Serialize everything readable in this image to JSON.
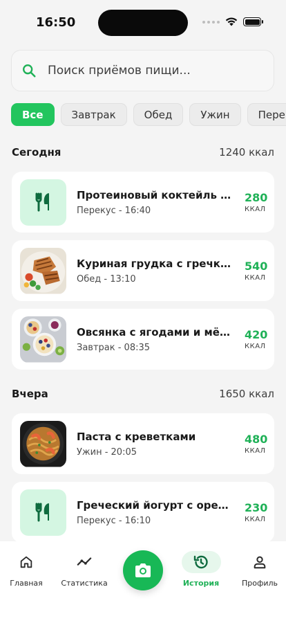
{
  "status_bar": {
    "time": "16:50"
  },
  "search": {
    "placeholder": "Поиск приёмов пищи..."
  },
  "filters": [
    {
      "label": "Все",
      "active": true
    },
    {
      "label": "Завтрак",
      "active": false
    },
    {
      "label": "Обед",
      "active": false
    },
    {
      "label": "Ужин",
      "active": false
    },
    {
      "label": "Перекус",
      "active": false
    }
  ],
  "sections": [
    {
      "title": "Сегодня",
      "total": "1240 ккал",
      "meals": [
        {
          "name": "Протеиновый коктейль с бананом",
          "meta": "Перекус - 16:40",
          "kcal": "280",
          "unit": "ККАЛ",
          "thumb": "fork-knife-icon"
        },
        {
          "name": "Куриная грудка с гречкой и овощами",
          "meta": "Обед - 13:10",
          "kcal": "540",
          "unit": "ККАЛ",
          "thumb": "chicken-photo"
        },
        {
          "name": "Овсянка с ягодами и мёдом",
          "meta": "Завтрак - 08:35",
          "kcal": "420",
          "unit": "ККАЛ",
          "thumb": "oatmeal-photo"
        }
      ]
    },
    {
      "title": "Вчера",
      "total": "1650 ккал",
      "meals": [
        {
          "name": "Паста с креветками",
          "meta": "Ужин - 20:05",
          "kcal": "480",
          "unit": "ККАЛ",
          "thumb": "pasta-photo"
        },
        {
          "name": "Греческий йогурт с орехами",
          "meta": "Перекус - 16:10",
          "kcal": "230",
          "unit": "ККАЛ",
          "thumb": "fork-knife-icon"
        }
      ]
    }
  ],
  "bottom_nav": [
    {
      "label": "Главная",
      "icon": "home-icon"
    },
    {
      "label": "Статистика",
      "icon": "stats-icon"
    },
    {
      "label": "История",
      "icon": "history-icon",
      "active": true
    },
    {
      "label": "Профиль",
      "icon": "profile-icon"
    }
  ],
  "colors": {
    "accent": "#22c55e",
    "accent_dark": "#1fb157",
    "thumb_bg": "#d4f6e2"
  }
}
